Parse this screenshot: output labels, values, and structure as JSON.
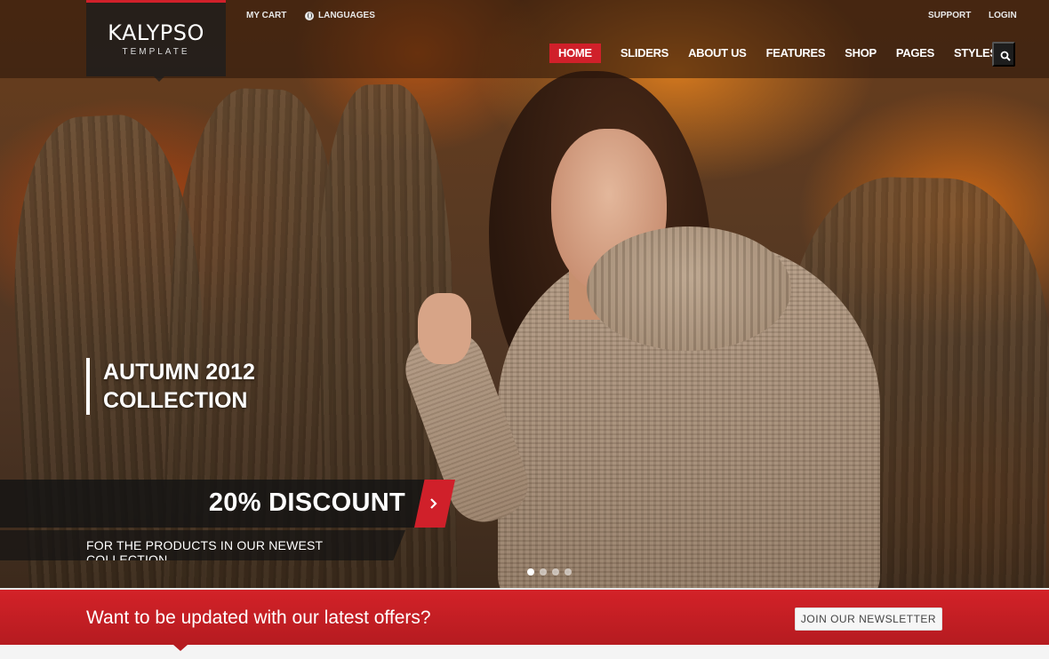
{
  "header": {
    "logo": {
      "name": "KALYPSO",
      "subtitle": "TEMPLATE"
    },
    "utility_left": [
      {
        "label": "MY CART"
      },
      {
        "label": "LANGUAGES",
        "icon": "globe-icon"
      }
    ],
    "utility_right": [
      {
        "label": "SUPPORT"
      },
      {
        "label": "LOGIN"
      }
    ],
    "nav": [
      {
        "label": "HOME",
        "active": true
      },
      {
        "label": "SLIDERS"
      },
      {
        "label": "ABOUT US"
      },
      {
        "label": "FEATURES"
      },
      {
        "label": "SHOP"
      },
      {
        "label": "PAGES"
      },
      {
        "label": "STYLES"
      }
    ],
    "search_icon": "search-icon"
  },
  "slider": {
    "title_line1": "AUTUMN 2012",
    "title_line2": "COLLECTION",
    "discount": "20% DISCOUNT",
    "subtitle": "FOR THE PRODUCTS IN OUR NEWEST COLLECTION",
    "arrow_icon": "chevron-right-icon",
    "dots": {
      "count": 4,
      "active_index": 0
    }
  },
  "newsletter": {
    "text": "Want to be updated with our latest offers?",
    "button_label": "JOIN OUR NEWSLETTER"
  },
  "colors": {
    "accent": "#d0202a",
    "dark_overlay": "#1d1d1d"
  }
}
